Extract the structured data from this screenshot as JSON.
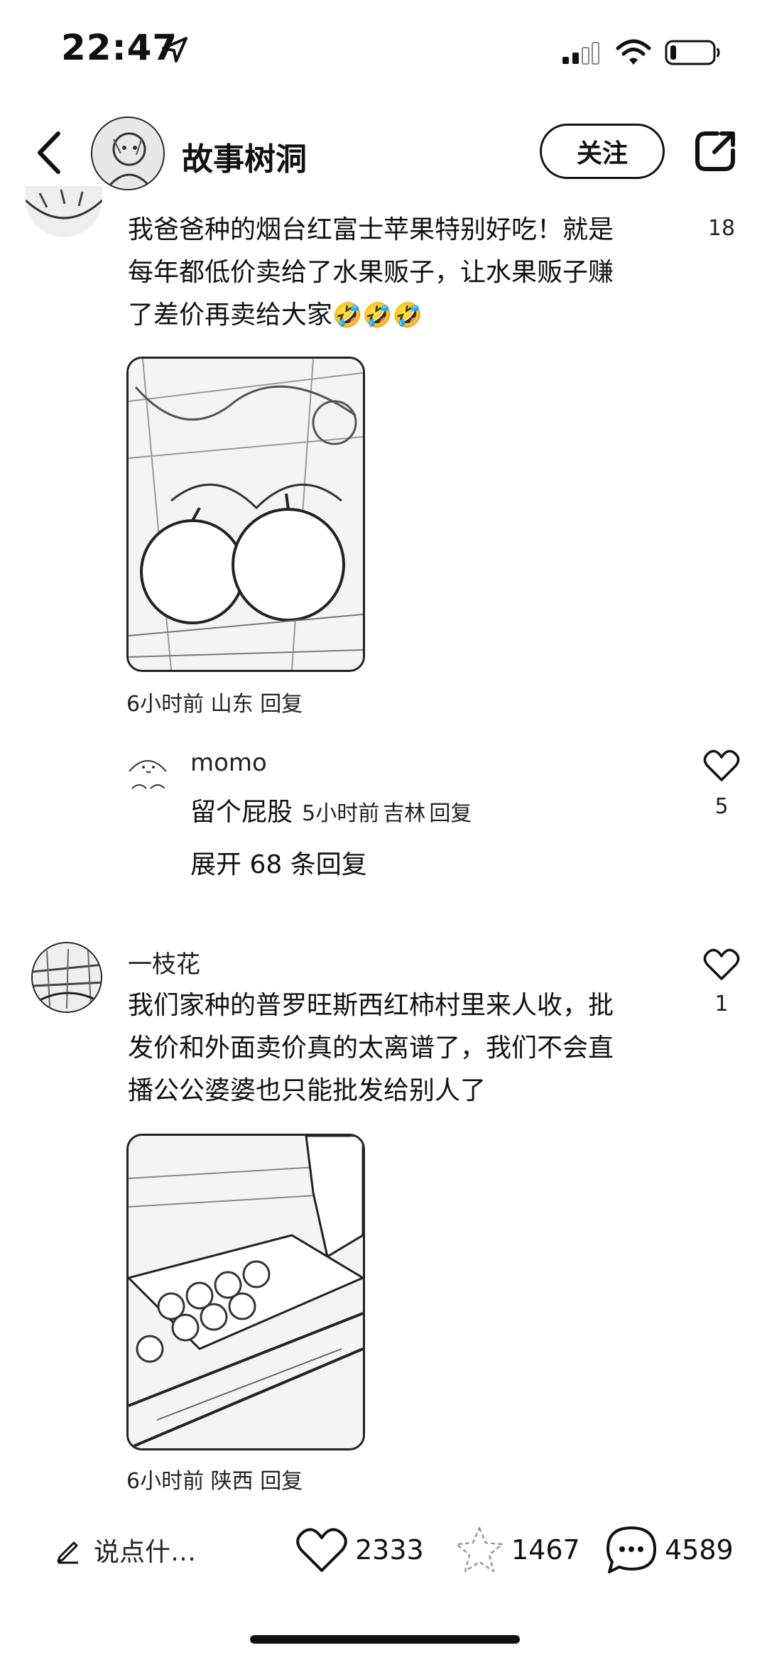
{
  "status_bar": {
    "time": "22:47"
  },
  "header": {
    "title": "故事树洞",
    "follow_label": "关注"
  },
  "comments": [
    {
      "text_lines": [
        "我爸爸种的烟台红富士苹果特别好吃！就是",
        "每年都低价卖给了水果贩子，让水果贩子赚",
        "了差价再卖给大家"
      ],
      "likes": "18",
      "time": "6小时前",
      "location": "山东",
      "reply_label": "回复",
      "photo_desc_icon": "apple-photo"
    },
    {
      "username": "一枝花",
      "text_lines": [
        "我们家种的普罗旺斯西红柿村里来人收，批",
        "发价和外面卖价真的太离谱了，我们不会直",
        "播公公婆婆也只能批发给别人了"
      ],
      "likes": "1",
      "time": "6小时前",
      "location": "陕西",
      "reply_label": "回复",
      "photo_desc_icon": "tomato-photo"
    }
  ],
  "reply": {
    "username": "momo",
    "text": "留个屁股",
    "time": "5小时前",
    "location": "吉林",
    "reply_label": "回复",
    "likes": "5"
  },
  "expand_replies": "展开 68 条回复",
  "bottom_bar": {
    "input_placeholder": "说点什…",
    "likes": "2333",
    "favorites": "1467",
    "comments": "4589"
  }
}
